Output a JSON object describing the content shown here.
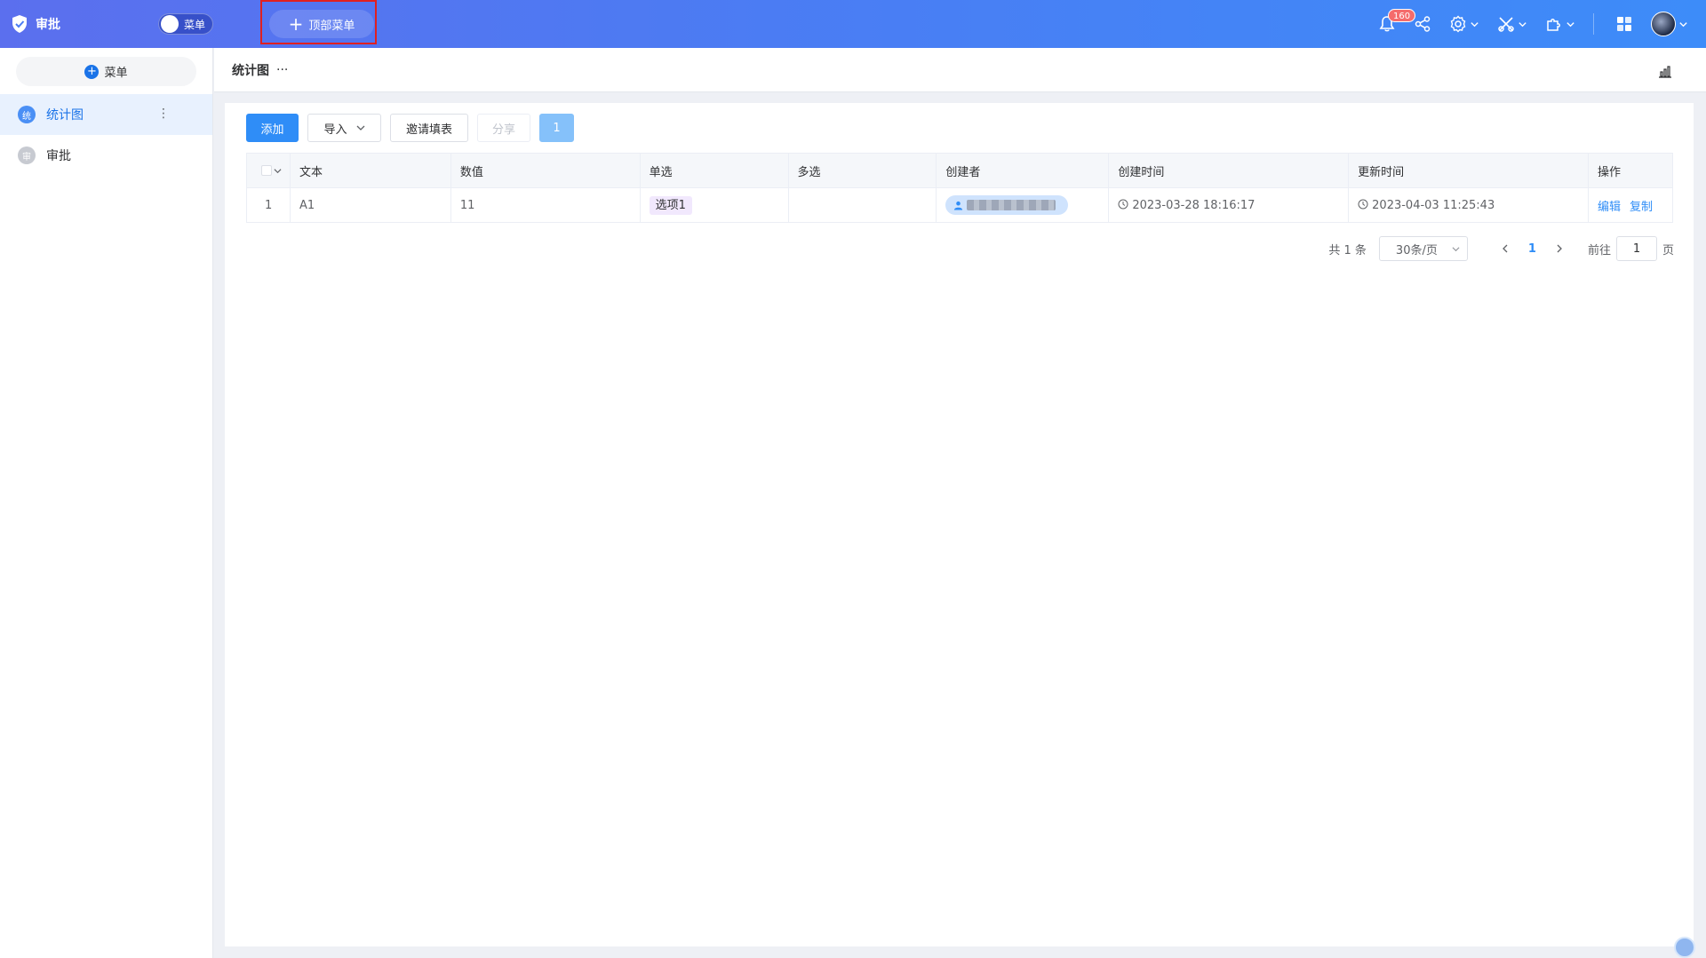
{
  "app": {
    "title": "审批",
    "toggle_label": "菜单",
    "top_menu_label": "顶部菜单"
  },
  "header_icons": {
    "notification_count": "160"
  },
  "sidebar": {
    "add_label": "菜单",
    "items": [
      {
        "icon_text": "统",
        "label": "统计图",
        "active": true
      },
      {
        "icon_text": "审",
        "label": "审批",
        "active": false
      }
    ]
  },
  "page": {
    "title": "统计图",
    "menu_dots": "···"
  },
  "toolbar": {
    "add_label": "添加",
    "import_label": "导入",
    "invite_label": "邀请填表",
    "share_label": "分享",
    "count_label": "1"
  },
  "table": {
    "columns": [
      "文本",
      "数值",
      "单选",
      "多选",
      "创建者",
      "创建时间",
      "更新时间",
      "操作"
    ],
    "rows": [
      {
        "index": "1",
        "text": "A1",
        "number": "11",
        "single": "选项1",
        "multi": "",
        "created_at": "2023-03-28 18:16:17",
        "updated_at": "2023-04-03 11:25:43",
        "edit": "编辑",
        "copy": "复制"
      }
    ]
  },
  "pagination": {
    "total": "共 1 条",
    "page_size": "30条/页",
    "current": "1",
    "goto_prefix": "前往",
    "goto_value": "1",
    "goto_suffix": "页"
  },
  "colors": {
    "primary": "#2f8df7",
    "topbar_start": "#5b6fee",
    "topbar_end": "#3d8cf9",
    "highlight": "#e02020"
  }
}
